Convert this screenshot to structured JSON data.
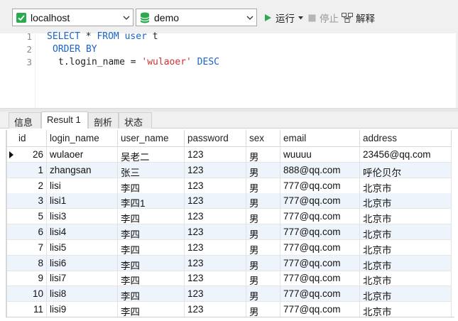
{
  "toolbar": {
    "connection": "localhost",
    "database": "demo",
    "run_label": "运行",
    "stop_label": "停止",
    "explain_label": "解释"
  },
  "editor": {
    "line_numbers": [
      "1",
      "2",
      "3"
    ],
    "line1": {
      "select": "SELECT",
      "star": " * ",
      "from": "FROM",
      "table": " user",
      "alias": " t"
    },
    "line2": {
      "order": "ORDER BY"
    },
    "line3": {
      "col": "t.login_name",
      "eq": " = ",
      "value": "'wulaoer'",
      "desc": " DESC"
    }
  },
  "tabs": [
    "信息",
    "Result 1",
    "剖析",
    "状态"
  ],
  "active_tab": 1,
  "grid": {
    "columns": [
      "id",
      "login_name",
      "user_name",
      "password",
      "sex",
      "email",
      "address"
    ],
    "rows": [
      [
        "26",
        "wulaoer",
        "吴老二",
        "123",
        "男",
        "wuuuu",
        "23456@qq.com"
      ],
      [
        "1",
        "zhangsan",
        "张三",
        "123",
        "男",
        "888@qq.com",
        "呼伦贝尔"
      ],
      [
        "2",
        "lisi",
        "李四",
        "123",
        "男",
        "777@qq.com",
        "北京市"
      ],
      [
        "3",
        "lisi1",
        "李四1",
        "123",
        "男",
        "777@qq.com",
        "北京市"
      ],
      [
        "5",
        "lisi3",
        "李四",
        "123",
        "男",
        "777@qq.com",
        "北京市"
      ],
      [
        "6",
        "lisi4",
        "李四",
        "123",
        "男",
        "777@qq.com",
        "北京市"
      ],
      [
        "7",
        "lisi5",
        "李四",
        "123",
        "男",
        "777@qq.com",
        "北京市"
      ],
      [
        "8",
        "lisi6",
        "李四",
        "123",
        "男",
        "777@qq.com",
        "北京市"
      ],
      [
        "9",
        "lisi7",
        "李四",
        "123",
        "男",
        "777@qq.com",
        "北京市"
      ],
      [
        "10",
        "lisi8",
        "李四",
        "123",
        "男",
        "777@qq.com",
        "北京市"
      ],
      [
        "11",
        "lisi9",
        "李四",
        "123",
        "男",
        "777@qq.com",
        "北京市"
      ]
    ]
  },
  "colors": {
    "keyword": "#1a63c8",
    "string": "#d03030",
    "run_green": "#2da94f",
    "selected_row": "#eef4fb"
  },
  "icons": {
    "connection": "server-connection-icon",
    "database": "database-icon",
    "run": "play-icon",
    "stop": "stop-icon",
    "explain": "explain-icon",
    "row_marker": "current-row-arrow-icon"
  }
}
